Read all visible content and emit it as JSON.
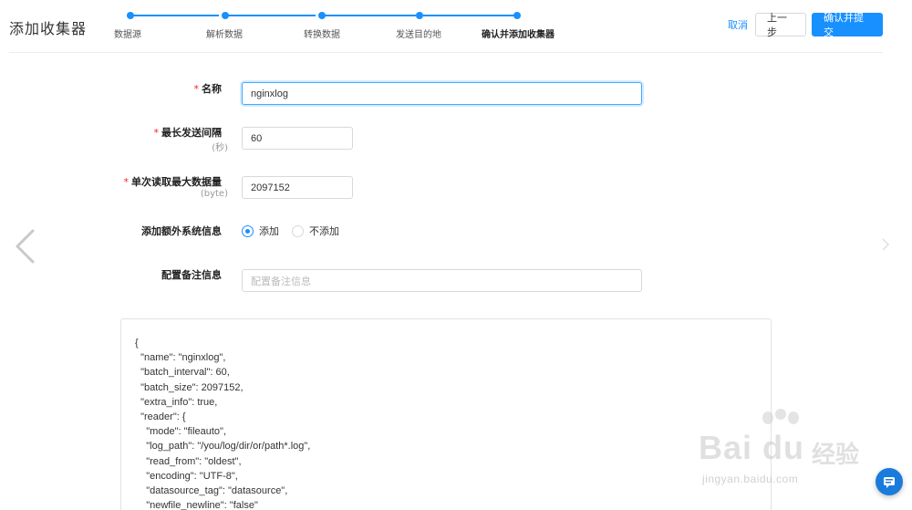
{
  "header": {
    "title": "添加收集器",
    "steps": [
      {
        "label": "数据源",
        "active": false
      },
      {
        "label": "解析数据",
        "active": false
      },
      {
        "label": "转换数据",
        "active": false
      },
      {
        "label": "发送目的地",
        "active": false
      },
      {
        "label": "确认并添加收集器",
        "active": true
      }
    ],
    "cancel_label": "取消",
    "prev_label": "上一步",
    "submit_label": "确认并提交",
    "accent_color": "#1890ff"
  },
  "form": {
    "name": {
      "label": "名称",
      "value": "nginxlog",
      "required": true
    },
    "batch_interval": {
      "label": "最长发送间隔",
      "sublabel": "(秒)",
      "value": "60",
      "required": true
    },
    "batch_size": {
      "label": "单次读取最大数据量",
      "sublabel": "(byte)",
      "value": "2097152",
      "required": true
    },
    "extra_info": {
      "label": "添加额外系统信息",
      "options": [
        "添加",
        "不添加"
      ],
      "selected": "添加"
    },
    "remark": {
      "label": "配置备注信息",
      "placeholder": "配置备注信息",
      "value": ""
    }
  },
  "config_preview": {
    "lines": [
      "{",
      "  \"name\": \"nginxlog\",",
      "  \"batch_interval\": 60,",
      "  \"batch_size\": 2097152,",
      "  \"extra_info\": true,",
      "  \"reader\": {",
      "    \"mode\": \"fileauto\",",
      "    \"log_path\": \"/you/log/dir/or/path*.log\",",
      "    \"read_from\": \"oldest\",",
      "    \"encoding\": \"UTF-8\",",
      "    \"datasource_tag\": \"datasource\",",
      "    \"newfile_newline\": \"false\""
    ]
  },
  "watermark": {
    "brand": "Bai du",
    "brand_cn": "经验",
    "url": "jingyan.baidu.com"
  },
  "icons": {
    "nav_left": "chevron-left-icon",
    "nav_right": "chevron-right-icon",
    "float": "chat-icon"
  }
}
